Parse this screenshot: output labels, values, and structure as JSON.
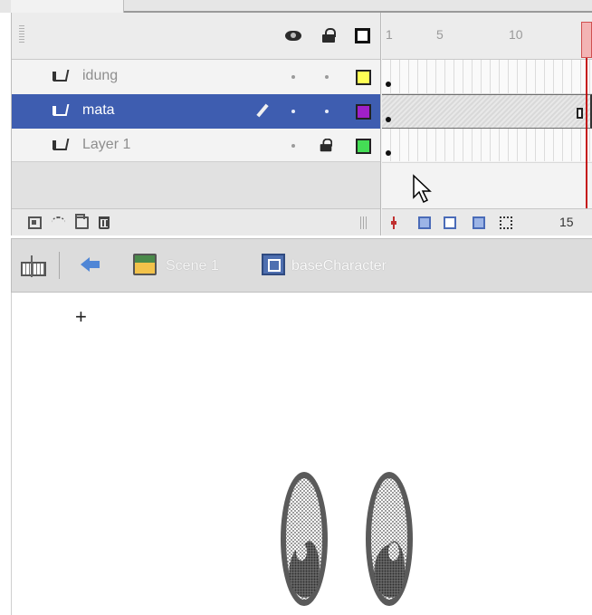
{
  "timeline": {
    "header_icons": [
      "eye-icon",
      "lock-icon",
      "outline-icon"
    ],
    "ruler_labels": [
      "1",
      "5",
      "10"
    ],
    "layers": [
      {
        "name": "idung",
        "selected": false,
        "locked": false,
        "editing": false,
        "outline_color": "#ffff55"
      },
      {
        "name": "mata",
        "selected": true,
        "locked": false,
        "editing": true,
        "outline_color": "#a020c8"
      },
      {
        "name": "Layer 1",
        "selected": false,
        "locked": true,
        "editing": false,
        "outline_color": "#44dd55"
      }
    ],
    "current_frame": "15"
  },
  "edit_bar": {
    "scene_label": "Scene 1",
    "symbol_label": "baseCharacter"
  },
  "stage": {
    "registration_mark": "+"
  },
  "colors": {
    "selected_row": "#3e5db0",
    "playhead": "#c00000"
  }
}
